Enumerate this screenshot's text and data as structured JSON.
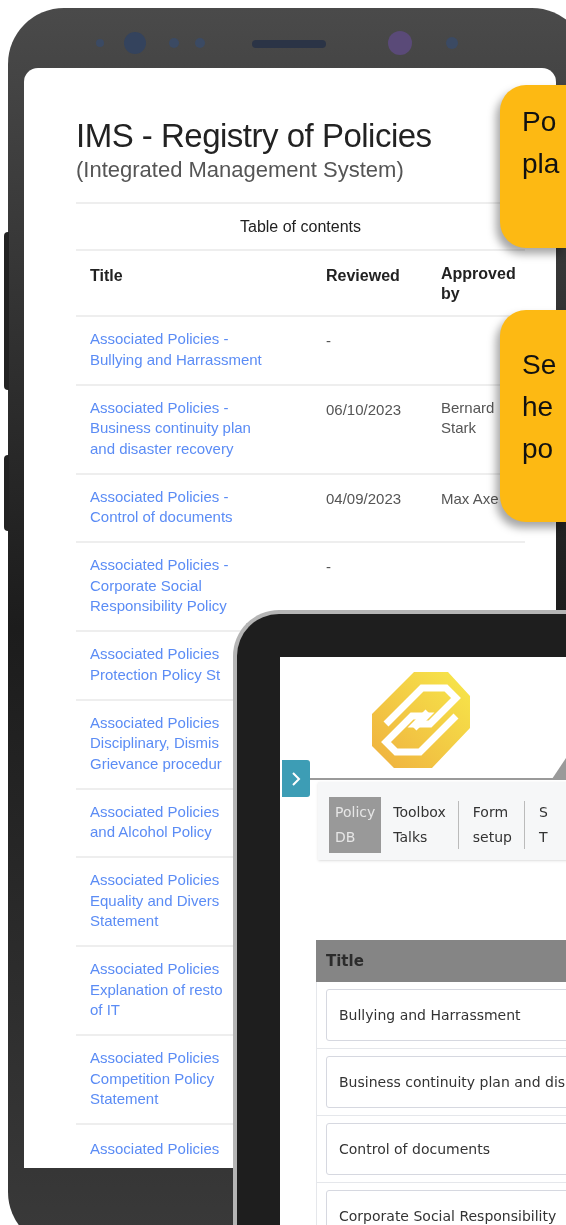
{
  "phone": {
    "title": "IMS - Registry of Policies",
    "subtitle": "(Integrated Management System)",
    "table": {
      "caption": "Table of contents",
      "columns": [
        "Title",
        "Reviewed",
        "Approved by"
      ],
      "rows": [
        {
          "title": "Associated Policies -\nBullying and Harrassment",
          "reviewed": "-"
        },
        {
          "title": "Associated Policies -\nBusiness continuity plan\nand disaster recovery",
          "reviewed": "06/10/2023",
          "approved_by": "Bernard\nStark"
        },
        {
          "title": "Associated Policies -\nControl of documents",
          "reviewed": "04/09/2023",
          "approved_by": "Max Axe"
        },
        {
          "title": "Associated Policies -\nCorporate Social\nResponsibility Policy",
          "reviewed": "-"
        },
        {
          "title": "Associated Policies\nProtection Policy St"
        },
        {
          "title": "Associated Policies\nDisciplinary, Dismis\nGrievance procedur"
        },
        {
          "title": "Associated Policies\nand Alcohol Policy"
        },
        {
          "title": "Associated Policies\nEquality and Divers\nStatement"
        },
        {
          "title": "Associated Policies\nExplanation of resto\nof IT"
        },
        {
          "title": "Associated Policies\nCompetition Policy\nStatement"
        },
        {
          "title": "Associated Policies"
        }
      ]
    }
  },
  "callouts": [
    {
      "text": "Po\npla"
    },
    {
      "text": "Se\nhe\npo"
    }
  ],
  "tablet": {
    "nav": [
      {
        "label": "Policy\nDB",
        "selected": true
      },
      {
        "label": "Toolbox\nTalks",
        "selected": false
      },
      {
        "label": "Form\nsetup",
        "selected": false
      },
      {
        "label": "S\nT",
        "selected": false
      }
    ],
    "table": {
      "columns": [
        "Title"
      ],
      "rows": [
        "Bullying and Harrassment",
        "Business continuity plan and dis",
        "Control of documents",
        "Corporate Social Responsibility"
      ]
    }
  }
}
